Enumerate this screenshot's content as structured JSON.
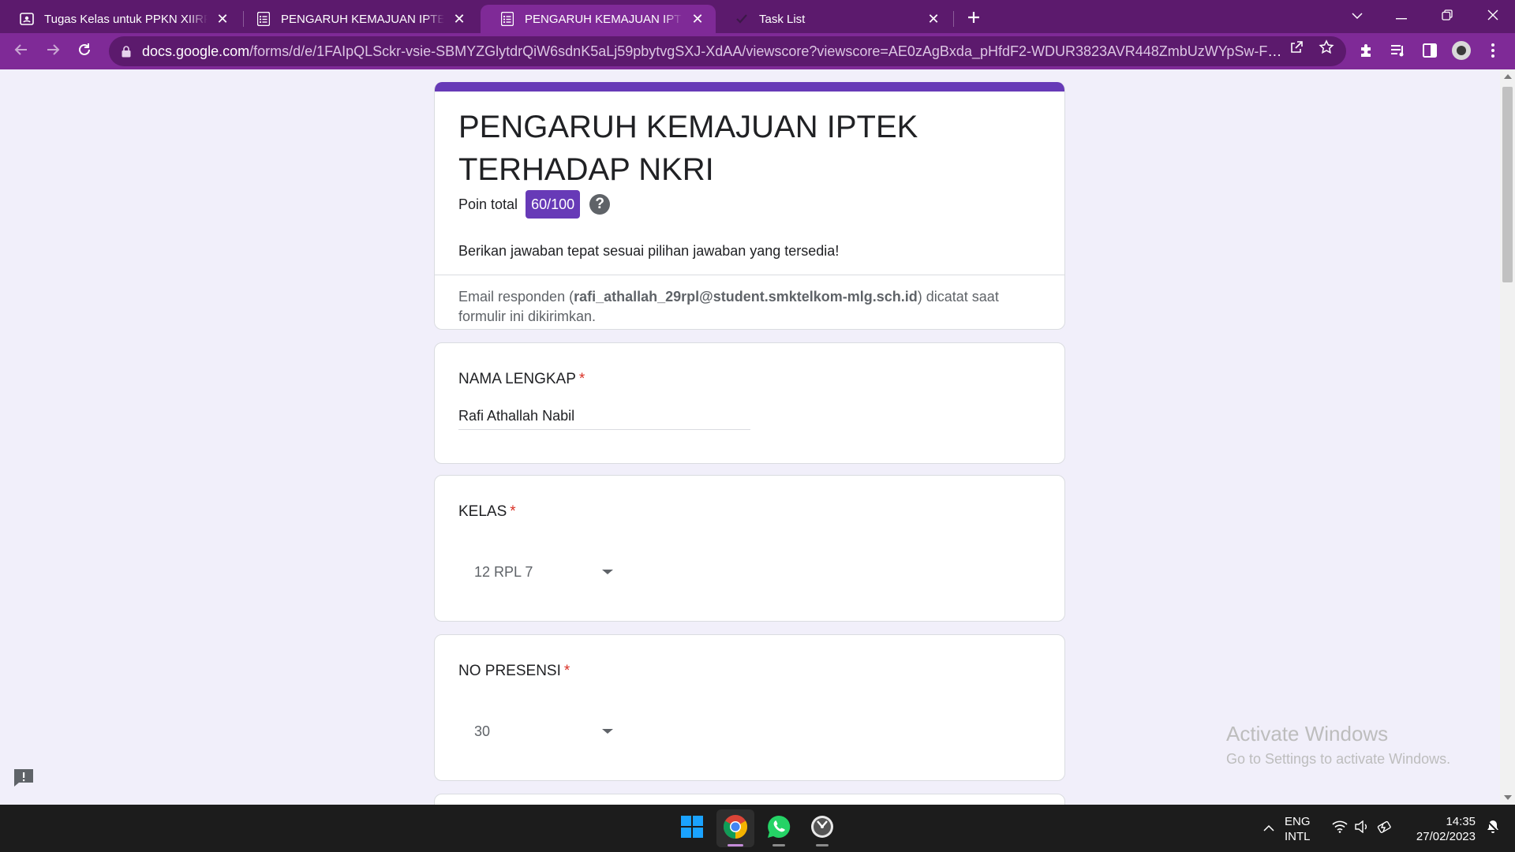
{
  "browser": {
    "tabs": [
      {
        "title": "Tugas Kelas untuk PPKN XIIRPL7",
        "icon": "classroom-icon",
        "active": false
      },
      {
        "title": "PENGARUH KEMAJUAN IPTEK TERHADAP NKRI",
        "icon": "forms-icon",
        "active": false
      },
      {
        "title": "PENGARUH KEMAJUAN IPTEK TERHADAP NKRI",
        "icon": "forms-icon",
        "active": true
      },
      {
        "title": "Task List",
        "icon": "check-icon",
        "active": false
      }
    ],
    "url_host": "docs.google.com",
    "url_path": "/forms/d/e/1FAIpQLSckr-vsie-SBMYZGlytdrQiW6sdnK5aLj59pbytvgSXJ-XdAA/viewscore?viewscore=AE0zAgBxda_pHfdF2-WDUR3823AVR448ZmbUzWYpSw-F3oHvhKU..."
  },
  "form": {
    "title": "PENGARUH KEMAJUAN IPTEK TERHADAP NKRI",
    "score_label": "Poin total",
    "score_value": "60/100",
    "help_symbol": "?",
    "description": "Berikan jawaban tepat sesuai pilihan jawaban yang tersedia!",
    "email_prefix": "Email responden (",
    "email": "rafi_athallah_29rpl@student.smktelkom-mlg.sch.id",
    "email_suffix": ") dicatat saat formulir ini dikirimkan.",
    "questions": [
      {
        "title": "NAMA LENGKAP",
        "required_mark": "*",
        "type": "text",
        "answer": "Rafi Athallah Nabil"
      },
      {
        "title": "KELAS",
        "required_mark": "*",
        "type": "dropdown",
        "answer": "12 RPL 7"
      },
      {
        "title": "NO PRESENSI",
        "required_mark": "*",
        "type": "dropdown",
        "answer": "30"
      }
    ]
  },
  "watermark": {
    "line1": "Activate Windows",
    "line2": "Go to Settings to activate Windows."
  },
  "taskbar": {
    "apps": [
      "windows-start-icon",
      "chrome-icon",
      "whatsapp-icon",
      "clock-app-icon"
    ],
    "lang_line1": "ENG",
    "lang_line2": "INTL",
    "time": "14:35",
    "date": "27/02/2023"
  },
  "colors": {
    "brand_purple": "#673ab7",
    "browser_frame": "#5c1a6d",
    "browser_toolbar": "#7f2a97",
    "required_red": "#d93025"
  }
}
